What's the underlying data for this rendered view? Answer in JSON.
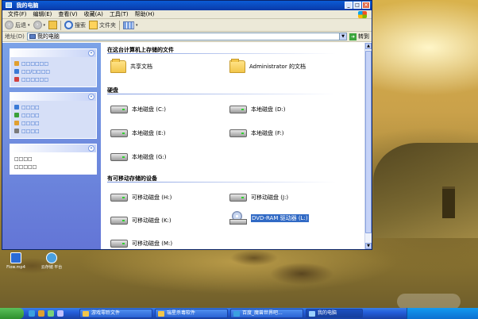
{
  "window": {
    "title": "我的电脑",
    "buttons": {
      "minimize": "_",
      "maximize": "□",
      "close": "×"
    }
  },
  "menu": [
    "文件(F)",
    "编辑(E)",
    "查看(V)",
    "收藏(A)",
    "工具(T)",
    "帮助(H)"
  ],
  "toolbar": {
    "back_label": "后退",
    "search_label": "搜索",
    "folders_label": "文件夹"
  },
  "address": {
    "label": "地址(D)",
    "value": "我的电脑",
    "go_label": "转到"
  },
  "sidebar": {
    "panels": [
      {
        "rows": [
          "□□□□□□",
          "□□/□□□□",
          "□□□□□□"
        ],
        "icon_colors": [
          "#e0a030",
          "#3a7ad6",
          "#d04040"
        ]
      },
      {
        "rows": [
          "□□□□",
          "□□□□",
          "□□□□",
          "□□□□"
        ],
        "icon_colors": [
          "#3a7ad6",
          "#3aa03a",
          "#e0a030",
          "#7a7a7a"
        ]
      },
      {
        "rows": [
          "□□□□",
          "□□□□□"
        ],
        "icon_colors": []
      }
    ]
  },
  "content": {
    "groups": {
      "stored": "在这台计算机上存储的文件",
      "hard": "硬盘",
      "removable": "有可移动存储的设备"
    },
    "folders": [
      "共享文档",
      "Administrator 的文档"
    ],
    "drives": [
      "本地磁盘 (C:)",
      "本地磁盘 (D:)",
      "本地磁盘 (E:)",
      "本地磁盘 (F:)",
      "本地磁盘 (G:)"
    ],
    "removable": [
      "可移动磁盘 (H:)",
      "可移动磁盘 (J:)",
      "可移动磁盘 (K:)",
      "DVD-RAM 驱动器 (L:)",
      "可移动磁盘 (M:)"
    ]
  },
  "desktop_icons": [
    "Flow.mp4",
    "云存储\n平台"
  ],
  "taskbar": {
    "tasks": [
      "游戏零聆文件",
      "瑞星杀毒软件",
      "百度_魔兽世界吧...",
      "我的电脑"
    ]
  }
}
